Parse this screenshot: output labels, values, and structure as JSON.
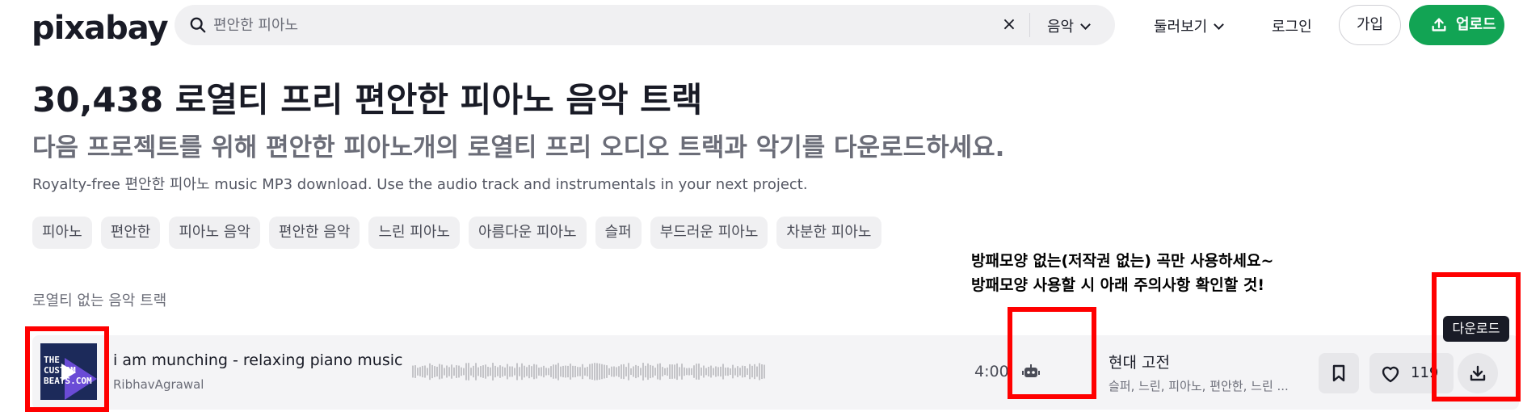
{
  "header": {
    "logo": "pixabay",
    "search": {
      "value": "",
      "placeholder": "편안한 피아노",
      "clear_icon": "close-icon",
      "category": "음악"
    },
    "nav": {
      "explore": "둘러보기",
      "login": "로그인",
      "join": "가입",
      "upload": "업로드"
    }
  },
  "page": {
    "title": "30,438 로열티 프리 편안한 피아노 음악 트랙",
    "subtitle": "다음 프로젝트를 위해 편안한 피아노개의 로열티 프리 오디오 트랙과 악기를 다운로드하세요.",
    "description": "Royalty-free 편안한 피아노 music MP3 download. Use the audio track and instrumentals in your next project."
  },
  "tags": [
    "피아노",
    "편안한",
    "피아노 음악",
    "편안한 음악",
    "느린 피아노",
    "아름다운 피아노",
    "슬퍼",
    "부드러운 피아노",
    "차분한 피아노"
  ],
  "annotation": {
    "line1": "방패모양 없는(저작권 없는) 곡만 사용하세요~",
    "line2": "방패모양 사용할 시 아래 주의사항 확인할 것!"
  },
  "section_label": "로열티 없는 음악 트랙",
  "track": {
    "thumb_text": "THE CUSTOM BEATS.COM",
    "title": "i am munching - relaxing piano music",
    "artist": "RibhavAgrawal",
    "duration": "4:00",
    "badge_icon": "robot-icon",
    "genre": "현대 고전",
    "keywords": "슬퍼, 느린, 피아노, 편안한, 느린 ...",
    "likes": "119",
    "download_tooltip": "다운로드"
  },
  "colors": {
    "brand_green": "#12a454",
    "highlight_red": "#ff0000",
    "text_dark": "#191b26"
  }
}
